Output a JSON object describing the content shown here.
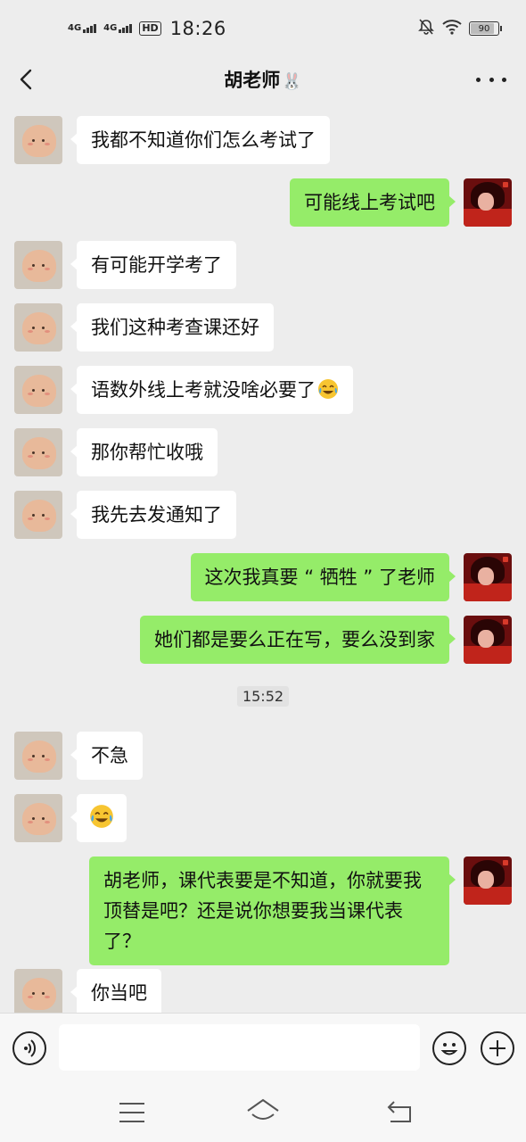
{
  "status_bar": {
    "network_1": "4G",
    "network_2": "4G",
    "hd_label": "HD",
    "time": "18:26",
    "battery": "90",
    "battery_level": 0.9,
    "icons": [
      "signal-icon",
      "hd-voice-icon",
      "mute-icon",
      "wifi-icon",
      "battery-icon"
    ]
  },
  "header": {
    "title": "胡老师",
    "title_emoji": "🐰",
    "icons": [
      "back-icon",
      "more-icon"
    ]
  },
  "messages": [
    {
      "side": "left",
      "text": "我都不知道你们怎么考试了"
    },
    {
      "side": "right",
      "text": "可能线上考试吧"
    },
    {
      "side": "left",
      "text": "有可能开学考了"
    },
    {
      "side": "left",
      "text": "我们这种考查课还好"
    },
    {
      "side": "left",
      "text": "语数外线上考就没啥必要了",
      "emoji": "laugh-cry-emoji"
    },
    {
      "side": "left",
      "text": "那你帮忙收哦"
    },
    {
      "side": "left",
      "text": "我先去发通知了"
    },
    {
      "side": "right",
      "text": "这次我真要 “ 牺牲 ” 了老师"
    },
    {
      "side": "right",
      "text": "她们都是要么正在写，要么没到家"
    },
    {
      "type": "timestamp",
      "text": "15:52"
    },
    {
      "side": "left",
      "text": "不急"
    },
    {
      "side": "left",
      "text": "",
      "emoji": "laugh-cry-emoji"
    },
    {
      "side": "right",
      "text": "胡老师，课代表要是不知道，你就要我顶替是吧？还是说你想要我当课代表了？"
    },
    {
      "side": "left",
      "text": "你当吧"
    }
  ],
  "input_bar": {
    "value": "",
    "icons": [
      "voice-icon",
      "emoji-icon",
      "plus-icon"
    ]
  },
  "system_nav": {
    "icons": [
      "menu-icon",
      "home-icon",
      "back-nav-icon"
    ]
  },
  "colors": {
    "background": "#ededed",
    "bubble_self": "#95ec69",
    "bubble_other": "#ffffff",
    "bottom_bar": "#f7f7f7"
  }
}
